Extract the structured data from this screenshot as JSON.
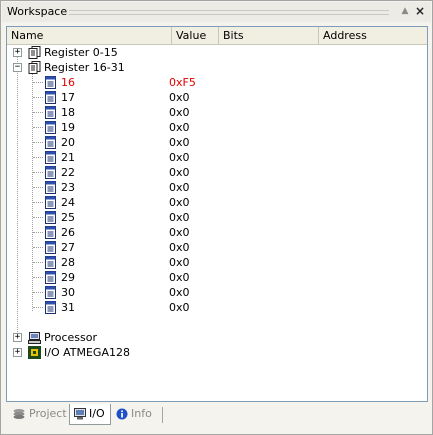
{
  "window": {
    "title": "Workspace",
    "autohide_glyph": "▲",
    "close_glyph": "×"
  },
  "columns": {
    "name": "Name",
    "value": "Value",
    "bits": "Bits",
    "address": "Address"
  },
  "tree": {
    "groups": [
      {
        "label": "Register 0-15",
        "expander": "+",
        "icon": "register-bank-icon"
      },
      {
        "label": "Register 16-31",
        "expander": "−",
        "icon": "register-bank-icon"
      },
      {
        "label": "Processor",
        "expander": "+",
        "icon": "processor-icon"
      },
      {
        "label": "I/O ATMEGA128",
        "expander": "+",
        "icon": "chip-icon"
      }
    ],
    "registers": [
      {
        "name": "16",
        "value": "0xF5",
        "changed": true
      },
      {
        "name": "17",
        "value": "0x0"
      },
      {
        "name": "18",
        "value": "0x0"
      },
      {
        "name": "19",
        "value": "0x0"
      },
      {
        "name": "20",
        "value": "0x0"
      },
      {
        "name": "21",
        "value": "0x0"
      },
      {
        "name": "22",
        "value": "0x0"
      },
      {
        "name": "23",
        "value": "0x0"
      },
      {
        "name": "24",
        "value": "0x0"
      },
      {
        "name": "25",
        "value": "0x0"
      },
      {
        "name": "26",
        "value": "0x0"
      },
      {
        "name": "27",
        "value": "0x0"
      },
      {
        "name": "28",
        "value": "0x0"
      },
      {
        "name": "29",
        "value": "0x0"
      },
      {
        "name": "30",
        "value": "0x0"
      },
      {
        "name": "31",
        "value": "0x0"
      }
    ]
  },
  "tabs": [
    {
      "label": "Project",
      "icon": "project-icon",
      "active": false
    },
    {
      "label": "I/O",
      "icon": "io-icon",
      "active": true
    },
    {
      "label": "Info",
      "icon": "info-icon",
      "active": false
    }
  ],
  "colors": {
    "changed_value": "#e00000",
    "accent": "#3a5bbf"
  }
}
